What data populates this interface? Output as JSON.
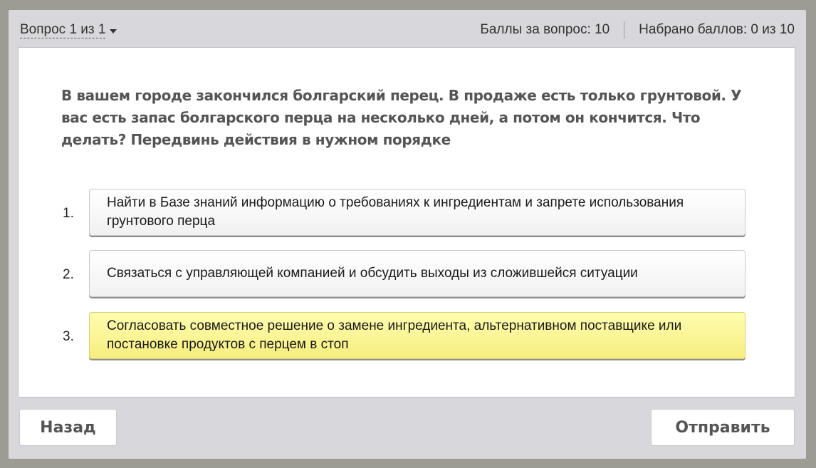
{
  "header": {
    "question_nav": "Вопрос 1 из 1",
    "points_per_question": "Баллы за вопрос: 10",
    "points_earned": "Набрано баллов: 0 из 10"
  },
  "question": {
    "text": "В вашем городе закончился болгарский перец. В продаже есть только грунтовой. У вас есть запас болгарского перца на несколько дней, а потом он кончится. Что делать? Передвинь действия в нужном порядке"
  },
  "answers": [
    {
      "num": "1.",
      "text": "Найти в Базе знаний информацию о требованиях к ингредиентам и запрете использования грунтового перца",
      "highlighted": false
    },
    {
      "num": "2.",
      "text": "Связаться с управляющей компанией и обсудить выходы из сложившейся ситуации",
      "highlighted": false
    },
    {
      "num": "3.",
      "text": "Согласовать совместное решение о замене ингредиента, альтернативном поставщике или постановке продуктов с перцем в стоп",
      "highlighted": true
    }
  ],
  "footer": {
    "back_label": "Назад",
    "submit_label": "Отправить"
  },
  "colors": {
    "highlight": "#f7ee7f",
    "frame": "#d8d7db"
  }
}
